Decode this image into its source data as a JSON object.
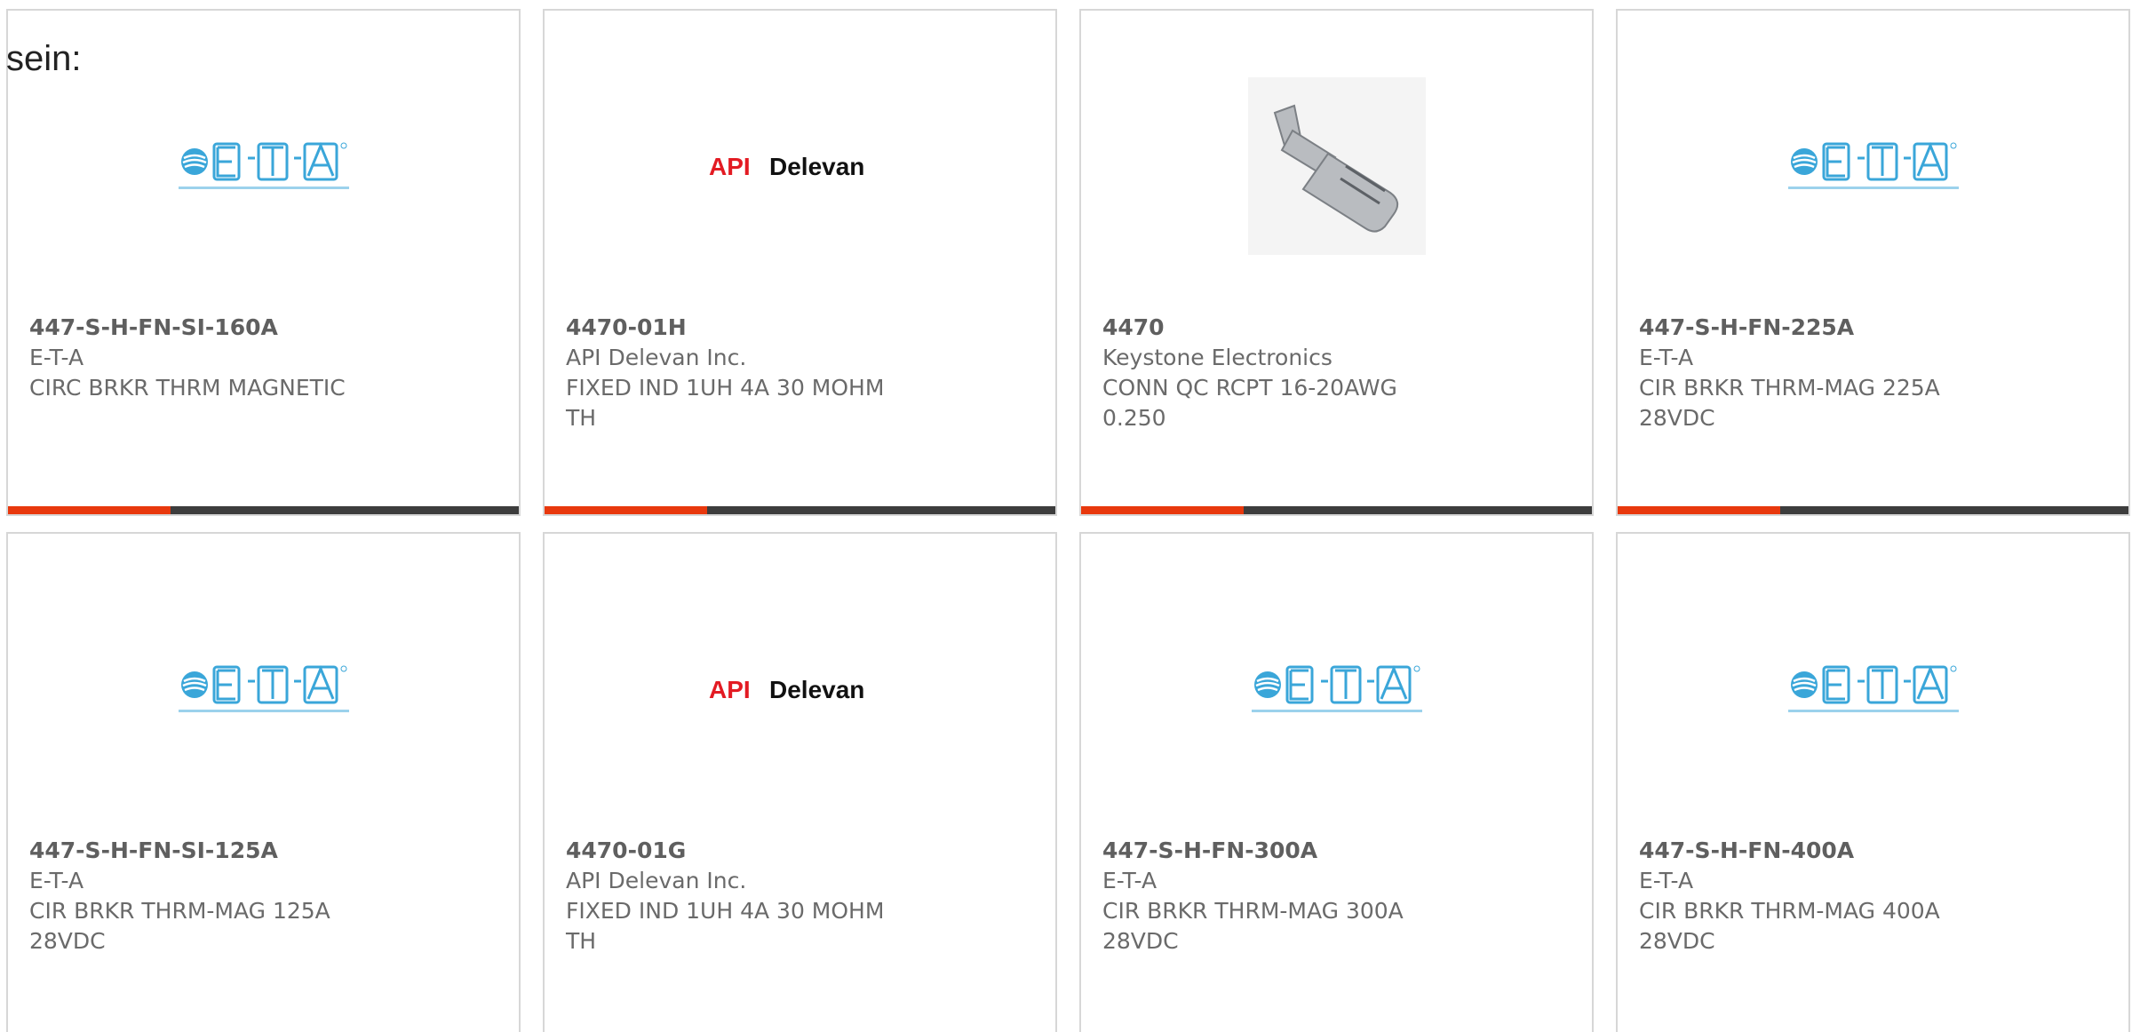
{
  "intro": {
    "text": "sein:"
  },
  "colors": {
    "accent": "#e8380d",
    "bar_dark": "#3d3d3d",
    "eta_blue": "#3aa6d9",
    "api_red": "#e31b23"
  },
  "products": [
    {
      "part_number": "447-S-H-FN-SI-160A",
      "manufacturer": "E-T-A",
      "description": "CIRC BRKR THRM MAGNETIC",
      "logo": "eta-logo",
      "has_accent_bar": true
    },
    {
      "part_number": "4470-01H",
      "manufacturer": "API Delevan Inc.",
      "description": "FIXED IND 1UH 4A 30 MOHM TH",
      "logo": "api-delevan-logo",
      "has_accent_bar": true
    },
    {
      "part_number": "4470",
      "manufacturer": "Keystone Electronics",
      "description": "CONN QC RCPT 16-20AWG 0.250",
      "logo": "connector-photo",
      "has_accent_bar": true
    },
    {
      "part_number": "447-S-H-FN-225A",
      "manufacturer": "E-T-A",
      "description": "CIR BRKR THRM-MAG 225A 28VDC",
      "logo": "eta-logo",
      "has_accent_bar": true
    },
    {
      "part_number": "447-S-H-FN-SI-125A",
      "manufacturer": "E-T-A",
      "description": "CIR BRKR THRM-MAG 125A 28VDC",
      "logo": "eta-logo",
      "has_accent_bar": false
    },
    {
      "part_number": "4470-01G",
      "manufacturer": "API Delevan Inc.",
      "description": "FIXED IND 1UH 4A 30 MOHM TH",
      "logo": "api-delevan-logo",
      "has_accent_bar": false
    },
    {
      "part_number": "447-S-H-FN-300A",
      "manufacturer": "E-T-A",
      "description": "CIR BRKR THRM-MAG 300A 28VDC",
      "logo": "eta-logo",
      "has_accent_bar": false
    },
    {
      "part_number": "447-S-H-FN-400A",
      "manufacturer": "E-T-A",
      "description": "CIR BRKR THRM-MAG 400A 28VDC",
      "logo": "eta-logo",
      "has_accent_bar": false
    }
  ]
}
